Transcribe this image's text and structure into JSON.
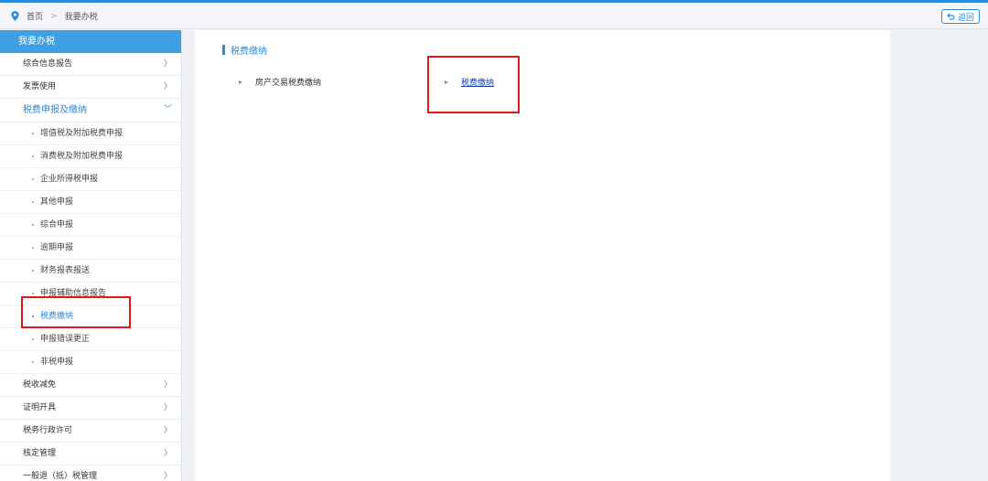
{
  "breadcrumb": {
    "home": "首页",
    "separator": ">",
    "current": "我要办税"
  },
  "back_button": "返回",
  "sidebar": {
    "header": "我要办税",
    "items_before": [
      {
        "label": "综合信息报告",
        "chevron": "〉"
      },
      {
        "label": "发票使用",
        "chevron": "〉"
      }
    ],
    "open_item": {
      "label": "税费申报及缴纳",
      "chevron": "﹀"
    },
    "sub_items": [
      {
        "label": "增值税及附加税费申报"
      },
      {
        "label": "消费税及附加税费申报"
      },
      {
        "label": "企业所得税申报"
      },
      {
        "label": "其他申报"
      },
      {
        "label": "综合申报"
      },
      {
        "label": "逾期申报"
      },
      {
        "label": "财务报表报送"
      },
      {
        "label": "申报辅助信息报告"
      },
      {
        "label": "税费缴纳"
      },
      {
        "label": "申报错误更正"
      },
      {
        "label": "非税申报"
      }
    ],
    "active_sub_index": 8,
    "items_after": [
      {
        "label": "税收减免",
        "chevron": "〉"
      },
      {
        "label": "证明开具",
        "chevron": "〉"
      },
      {
        "label": "税务行政许可",
        "chevron": "〉"
      },
      {
        "label": "核定管理",
        "chevron": "〉"
      },
      {
        "label": "一般退（抵）税管理",
        "chevron": "〉"
      }
    ]
  },
  "panel": {
    "title": "税费缴纳",
    "links": [
      {
        "label": "房产交易税费缴纳"
      },
      {
        "label": "税费缴纳"
      }
    ]
  },
  "colors": {
    "accent": "#2b8ad8",
    "highlight_box": "#e3161b"
  }
}
